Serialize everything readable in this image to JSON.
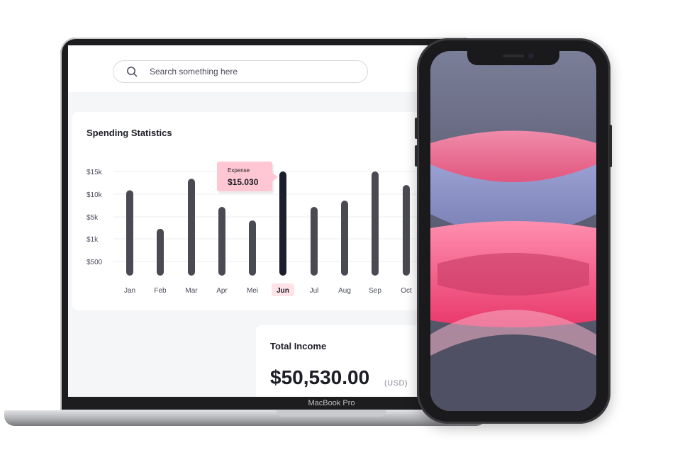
{
  "search": {
    "placeholder": "Search something here"
  },
  "spending": {
    "title": "Spending Statistics",
    "tooltip": {
      "label": "Expense",
      "value": "$15.030"
    },
    "selected_month": "Jun"
  },
  "chart_data": {
    "type": "bar",
    "title": "Spending Statistics",
    "categories": [
      "Jan",
      "Feb",
      "Mar",
      "Apr",
      "Mei",
      "Jun",
      "Jul",
      "Aug",
      "Sep",
      "Oct"
    ],
    "y_tick_labels": [
      "$15k",
      "$10k",
      "$5k",
      "$1k",
      "$500"
    ],
    "values_fraction_of_15k_gridline": [
      0.82,
      0.45,
      0.93,
      0.66,
      0.53,
      1.0,
      0.66,
      0.72,
      1.0,
      0.87
    ],
    "highlight_index": 5,
    "grid": true,
    "colors": {
      "bar": "#4a4a52",
      "highlight_bar": "#1c1e2b",
      "tooltip_bg": "#ffc7d3",
      "highlight_label_bg": "#ffe3e8"
    }
  },
  "income": {
    "title": "Total Income",
    "value": "$50,530.00",
    "unit": "(USD)"
  },
  "device": {
    "laptop_label": "MacBook Pro"
  }
}
